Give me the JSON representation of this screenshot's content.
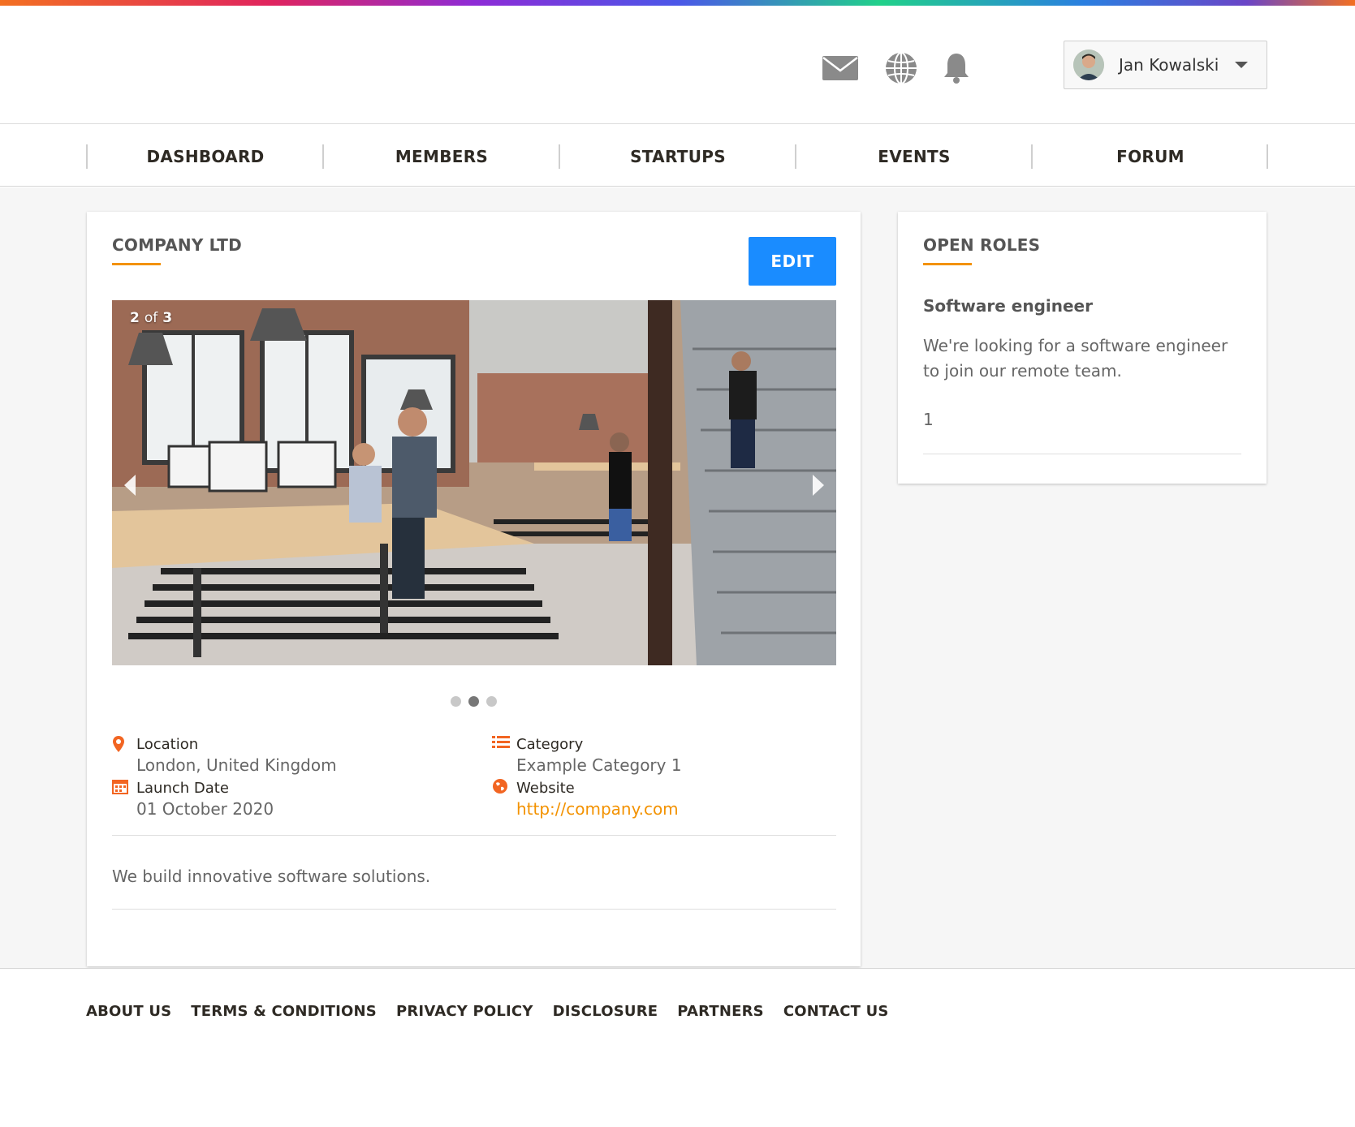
{
  "header": {
    "user_name": "Jan Kowalski",
    "icons": [
      "mail-icon",
      "globe-icon",
      "bell-icon",
      "chevron-down-icon"
    ]
  },
  "nav": {
    "items": [
      {
        "label": "DASHBOARD"
      },
      {
        "label": "MEMBERS"
      },
      {
        "label": "STARTUPS"
      },
      {
        "label": "EVENTS"
      },
      {
        "label": "FORUM"
      }
    ]
  },
  "company": {
    "title": "COMPANY LTD",
    "edit_label": "EDIT",
    "carousel": {
      "current": "2",
      "of_label": "of",
      "total": "3",
      "active_index": 1,
      "dot_count": 3
    },
    "location": {
      "label": "Location",
      "value": "London, United Kingdom"
    },
    "launch_date": {
      "label": "Launch Date",
      "value": "01 October 2020"
    },
    "category": {
      "label": "Category",
      "value": "Example Category 1"
    },
    "website": {
      "label": "Website",
      "value": "http://company.com"
    },
    "description": "We build innovative software solutions."
  },
  "open_roles": {
    "title": "OPEN ROLES",
    "roles": [
      {
        "title": "Software engineer",
        "description": "We're looking for a software engineer to join our remote team.",
        "count": "1"
      }
    ]
  },
  "footer": {
    "links": [
      "ABOUT US",
      "TERMS & CONDITIONS",
      "PRIVACY POLICY",
      "DISCLOSURE",
      "PARTNERS",
      "CONTACT US"
    ]
  },
  "colors": {
    "accent": "#f39200",
    "primary_button": "#1a8cff",
    "icon_orange": "#f26522"
  }
}
